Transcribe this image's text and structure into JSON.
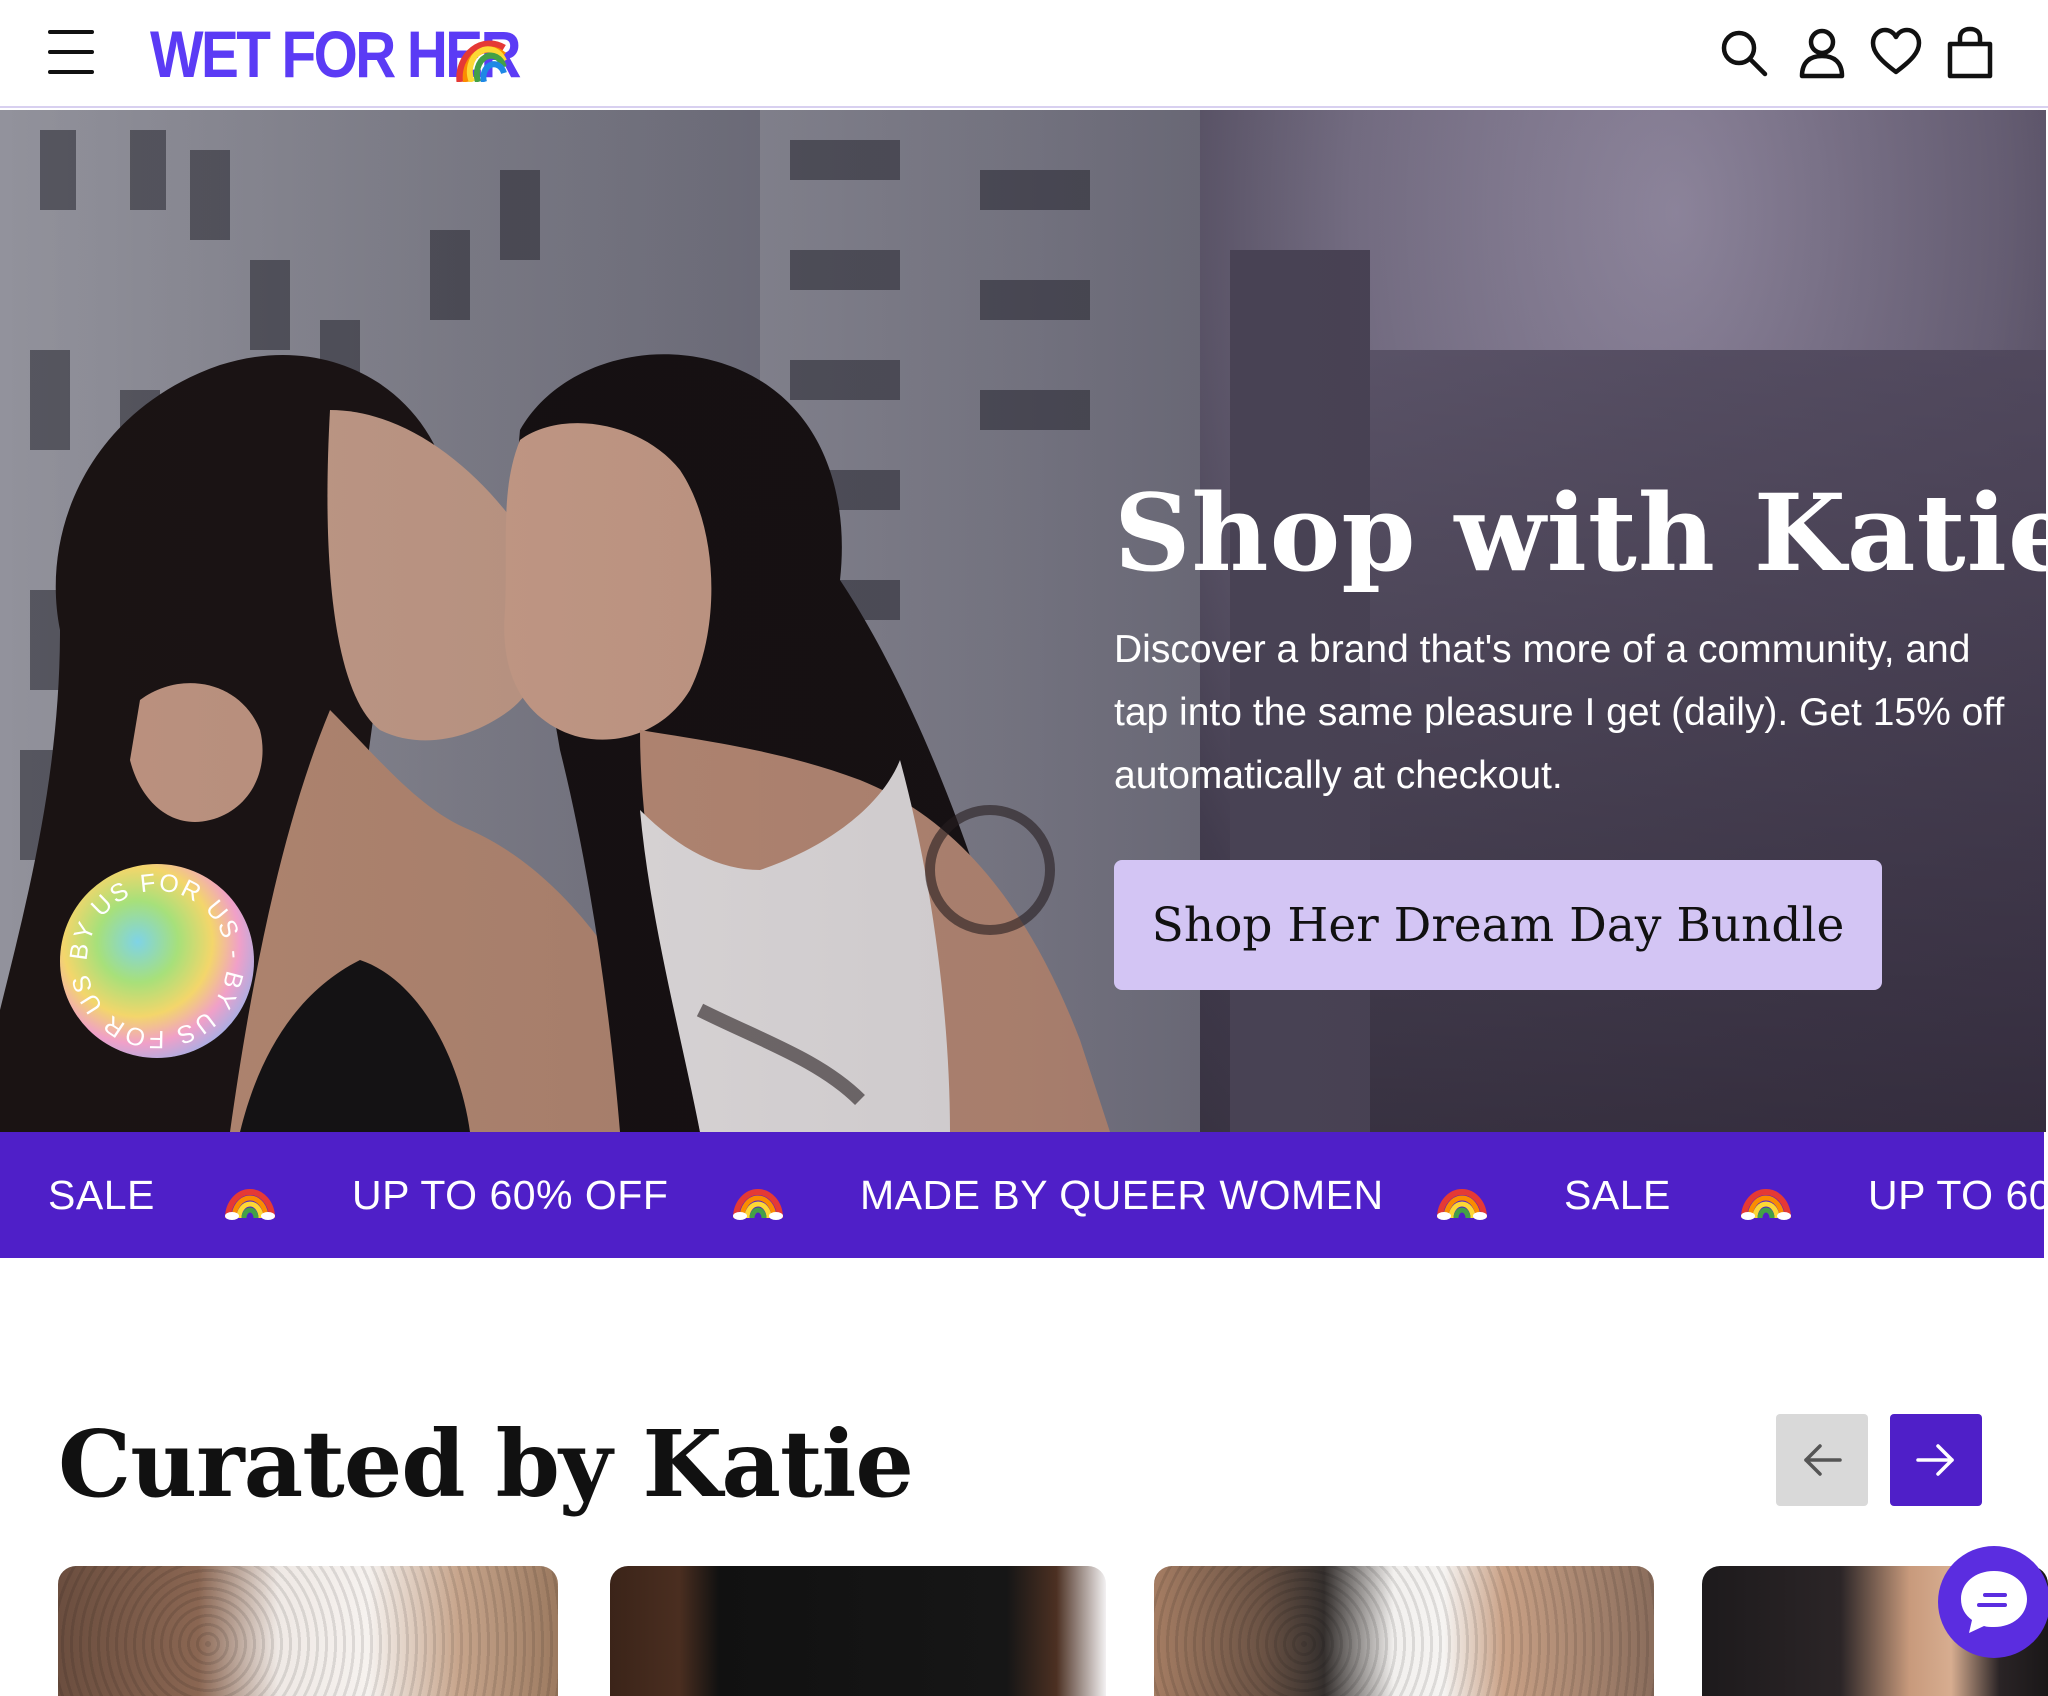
{
  "header": {
    "logo_text": "WET FOR HER",
    "icons": [
      "menu-icon",
      "search-icon",
      "account-icon",
      "heart-icon",
      "bag-icon"
    ],
    "brand_color": "#5b3bf5"
  },
  "hero": {
    "title": "Shop with Katie",
    "body": "Discover a brand that's more of a community, and tap into the same pleasure I get (daily). Get 15% off automatically at checkout.",
    "cta_label": "Shop Her Dream Day Bundle",
    "cta_color": "#d3c5f4",
    "badge_text": "BY US FOR US - BY US FOR US - "
  },
  "marquee": {
    "background": "#4f1fc8",
    "items": [
      "SALE",
      "UP TO 60% OFF",
      "MADE BY QUEER WOMEN",
      "SALE",
      "UP TO 60"
    ]
  },
  "curated": {
    "title": "Curated by Katie",
    "prev_icon": "arrow-left-icon",
    "next_icon": "arrow-right-icon",
    "accent": "#4f1fc8"
  },
  "chat": {
    "icon": "chat-icon",
    "color": "#5b2de0"
  }
}
